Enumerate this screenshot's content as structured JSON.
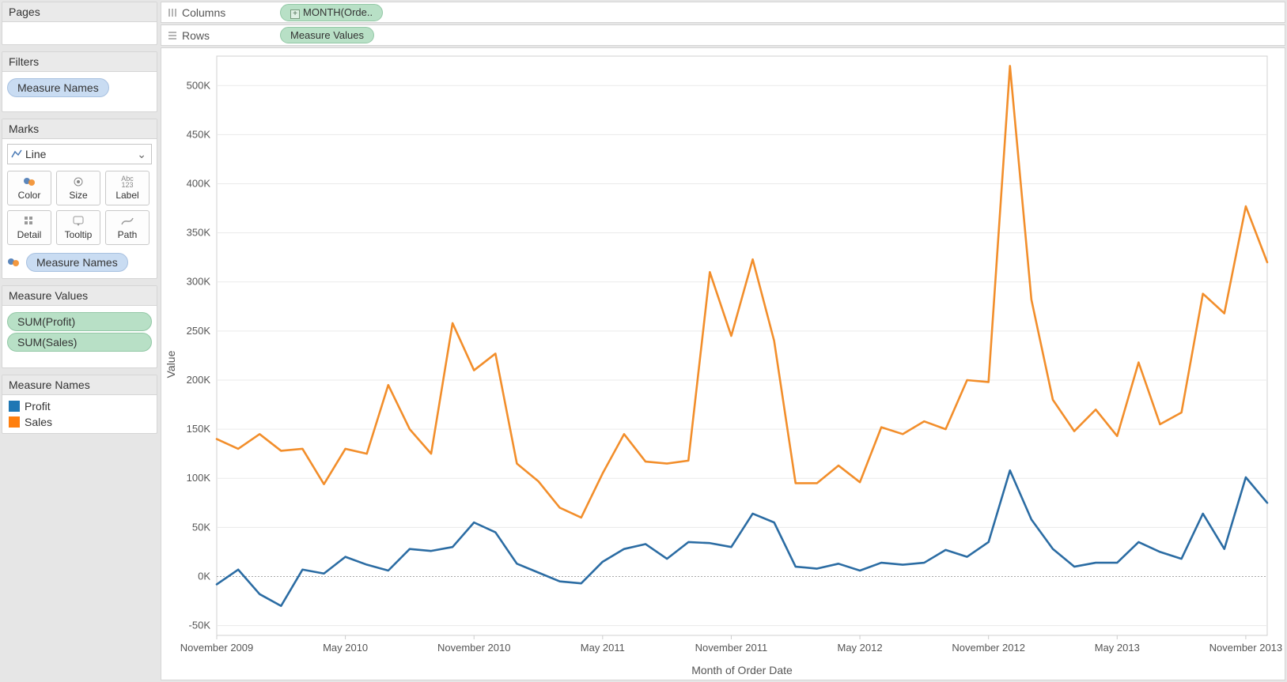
{
  "shelves": {
    "columns_label": "Columns",
    "columns_pill": "MONTH(Orde..",
    "rows_label": "Rows",
    "rows_pill": "Measure Values"
  },
  "pages": {
    "title": "Pages"
  },
  "filters": {
    "title": "Filters",
    "pill": "Measure Names"
  },
  "marks": {
    "title": "Marks",
    "type": "Line",
    "buttons": [
      "Color",
      "Size",
      "Label",
      "Detail",
      "Tooltip",
      "Path"
    ],
    "color_pill": "Measure Names"
  },
  "measure_values": {
    "title": "Measure Values",
    "items": [
      "SUM(Profit)",
      "SUM(Sales)"
    ]
  },
  "legend": {
    "title": "Measure Names",
    "items": [
      {
        "label": "Profit",
        "color": "#1f77b4"
      },
      {
        "label": "Sales",
        "color": "#ff7f0e"
      }
    ]
  },
  "chart_data": {
    "type": "line",
    "xlabel": "Month of Order Date",
    "ylabel": "Value",
    "ylim": [
      -60000,
      530000
    ],
    "y_ticks": [
      -50000,
      0,
      50000,
      100000,
      150000,
      200000,
      250000,
      300000,
      350000,
      400000,
      450000,
      500000
    ],
    "y_tick_labels": [
      "-50K",
      "0K",
      "50K",
      "100K",
      "150K",
      "200K",
      "250K",
      "300K",
      "350K",
      "400K",
      "450K",
      "500K"
    ],
    "x_tick_labels": [
      "November 2009",
      "May 2010",
      "November 2010",
      "May 2011",
      "November 2011",
      "May 2012",
      "November 2012",
      "May 2013",
      "November 2013"
    ],
    "x_tick_positions": [
      0,
      6,
      12,
      18,
      24,
      30,
      36,
      42,
      48
    ],
    "n_points": 50,
    "series": [
      {
        "name": "Profit",
        "color": "#2b6ca3",
        "values": [
          -8000,
          7000,
          -18000,
          -30000,
          7000,
          3000,
          20000,
          12000,
          6000,
          28000,
          26000,
          30000,
          55000,
          45000,
          13000,
          4000,
          -5000,
          -7000,
          15000,
          28000,
          33000,
          18000,
          35000,
          34000,
          30000,
          64000,
          55000,
          10000,
          8000,
          13000,
          6000,
          14000,
          12000,
          14000,
          27000,
          20000,
          35000,
          108000,
          58000,
          28000,
          10000,
          14000,
          14000,
          35000,
          25000,
          18000,
          64000,
          28000,
          101000,
          75000
        ]
      },
      {
        "name": "Sales",
        "color": "#f28e2b",
        "values": [
          140000,
          130000,
          145000,
          128000,
          130000,
          94000,
          130000,
          125000,
          195000,
          150000,
          125000,
          258000,
          210000,
          227000,
          115000,
          97000,
          70000,
          60000,
          105000,
          145000,
          117000,
          115000,
          118000,
          310000,
          245000,
          323000,
          240000,
          95000,
          95000,
          113000,
          96000,
          152000,
          145000,
          158000,
          150000,
          200000,
          198000,
          520000,
          282000,
          180000,
          148000,
          170000,
          143000,
          218000,
          155000,
          167000,
          288000,
          268000,
          377000,
          320000
        ]
      }
    ]
  }
}
